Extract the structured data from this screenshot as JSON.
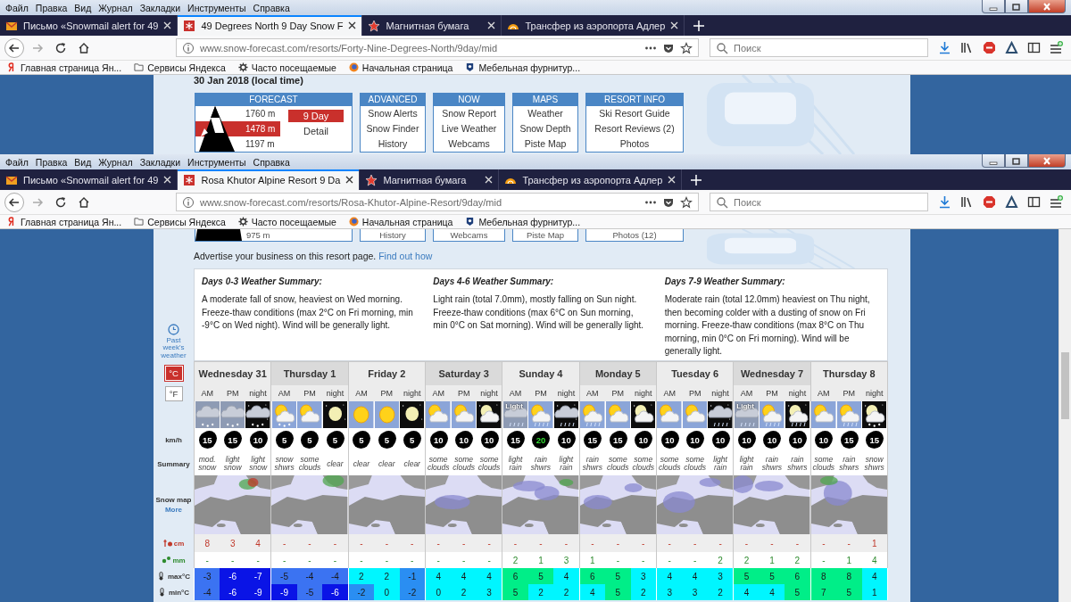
{
  "windows": [
    {
      "menu": [
        "Файл",
        "Правка",
        "Вид",
        "Журнал",
        "Закладки",
        "Инструменты",
        "Справка"
      ],
      "tabs": [
        {
          "title": "Письмо «Snowmail alert for 49",
          "selected": false
        },
        {
          "title": "49 Degrees North 9 Day Snow F",
          "selected": true
        },
        {
          "title": "Магнитная бумага",
          "selected": false
        },
        {
          "title": "Трансфер из аэропорта Адлер",
          "selected": false
        }
      ],
      "address": {
        "url": "www.snow-forecast.com/resorts/Forty-Nine-Degrees-North/9day/mid"
      },
      "search": {
        "placeholder": "Поиск"
      },
      "bookmarks": [
        "Главная страница Ян...",
        "Сервисы Яндекса",
        "Часто посещаемые",
        "Начальная страница",
        "Мебельная фурнитур..."
      ],
      "page": {
        "kind": "resort-menu",
        "date": "30 Jan 2018 (local time)",
        "forecast": {
          "title": "FORECAST",
          "elevations": [
            {
              "label": "1760 m",
              "selected": false
            },
            {
              "label": "1478 m",
              "selected": true
            },
            {
              "label": "1197 m",
              "selected": false
            }
          ],
          "views": [
            {
              "label": "9 Day",
              "selected": true
            },
            {
              "label": "Detail",
              "selected": false
            }
          ]
        },
        "menus": [
          {
            "title": "ADVANCED",
            "items": [
              "Snow Alerts",
              "Snow Finder",
              "History"
            ]
          },
          {
            "title": "NOW",
            "items": [
              "Snow Report",
              "Live Weather",
              "Webcams"
            ]
          },
          {
            "title": "MAPS",
            "items": [
              "Weather",
              "Snow Depth",
              "Piste Map"
            ]
          },
          {
            "title": "RESORT INFO",
            "items": [
              "Ski Resort Guide",
              "Resort Reviews (2)",
              "Photos"
            ]
          }
        ]
      }
    },
    {
      "menu": [
        "Файл",
        "Правка",
        "Вид",
        "Журнал",
        "Закладки",
        "Инструменты",
        "Справка"
      ],
      "tabs": [
        {
          "title": "Письмо «Snowmail alert for 49",
          "selected": false
        },
        {
          "title": "Rosa Khutor Alpine Resort 9 Da",
          "selected": true
        },
        {
          "title": "Магнитная бумага",
          "selected": false
        },
        {
          "title": "Трансфер из аэропорта Адлер",
          "selected": false
        }
      ],
      "address": {
        "url": "www.snow-forecast.com/resorts/Rosa-Khutor-Alpine-Resort/9day/mid"
      },
      "search": {
        "placeholder": "Поиск"
      },
      "bookmarks": [
        "Главная страница Ян...",
        "Сервисы Яндекса",
        "Часто посещаемые",
        "Начальная страница",
        "Мебельная фурнитур..."
      ],
      "page": {
        "kind": "forecast",
        "nav_strip": {
          "elevation": "975 m",
          "items": [
            "History",
            "Webcams",
            "Piste Map",
            "Photos (12)"
          ]
        },
        "advert": {
          "text": "Advertise your business on this resort page.",
          "link": "Find out how"
        },
        "past_weather": "Past week's weather",
        "units": [
          {
            "label": "°C",
            "selected": true
          },
          {
            "label": "°F",
            "selected": false
          }
        ],
        "row_labels": {
          "wind": "km/h",
          "summary": "Summary",
          "snow_map": "Snow map",
          "more": "More",
          "snow": "cm",
          "rain": "mm",
          "max": "max°C",
          "min": "min°C"
        },
        "summaries": [
          {
            "title": "Days 0-3 Weather Summary:",
            "text": "A moderate fall of snow, heaviest on Wed morning. Freeze-thaw conditions (max 2°C on Fri morning, min -9°C on Wed night). Wind will be generally light."
          },
          {
            "title": "Days 4-6 Weather Summary:",
            "text": "Light rain (total 7.0mm), mostly falling on Sun night. Freeze-thaw conditions (max 6°C on Sun morning, min 0°C on Sat morning). Wind will be generally light."
          },
          {
            "title": "Days 7-9 Weather Summary:",
            "text": "Moderate rain (total 12.0mm) heaviest on Thu night, then becoming colder with a dusting of snow on Fri morning. Freeze-thaw conditions (max 8°C on Thu morning, min 0°C on Fri morning). Wind will be generally light."
          }
        ],
        "days": [
          {
            "name": "Wednesday 31",
            "periods": [
              {
                "label": "AM",
                "kind": "cloud-snow",
                "wind": {
                  "speed": "15",
                  "gusty": false
                },
                "summary": "mod. snow",
                "snow": "8",
                "rain": "-",
                "max": {
                  "value": "-3",
                  "color": "#3b73f2"
                },
                "min": {
                  "value": "-4",
                  "color": "#3b73f2"
                }
              },
              {
                "label": "PM",
                "kind": "cloud-snow",
                "wind": {
                  "speed": "15",
                  "gusty": false
                },
                "summary": "light snow",
                "snow": "3",
                "rain": "-",
                "max": {
                  "value": "-6",
                  "color": "#0a14e6"
                },
                "min": {
                  "value": "-6",
                  "color": "#0a14e6"
                }
              },
              {
                "label": "night",
                "kind": "night-cloud-snow",
                "wind": {
                  "speed": "10",
                  "gusty": false
                },
                "summary": "light snow",
                "snow": "4",
                "rain": "-",
                "max": {
                  "value": "-7",
                  "color": "#0a14e6"
                },
                "min": {
                  "value": "-9",
                  "color": "#0a14e6"
                }
              }
            ]
          },
          {
            "name": "Thursday 1",
            "periods": [
              {
                "label": "AM",
                "kind": "sun-cloud-snow",
                "wind": {
                  "speed": "5",
                  "gusty": false
                },
                "summary": "snow shwrs",
                "snow": "-",
                "rain": "-",
                "max": {
                  "value": "-5",
                  "color": "#3b73f2"
                },
                "min": {
                  "value": "-9",
                  "color": "#0a14e6"
                }
              },
              {
                "label": "PM",
                "kind": "sun-cloud",
                "wind": {
                  "speed": "5",
                  "gusty": false
                },
                "summary": "some clouds",
                "snow": "-",
                "rain": "-",
                "max": {
                  "value": "-4",
                  "color": "#3b73f2"
                },
                "min": {
                  "value": "-5",
                  "color": "#3b73f2"
                }
              },
              {
                "label": "night",
                "kind": "moon",
                "wind": {
                  "speed": "5",
                  "gusty": false
                },
                "summary": "clear",
                "snow": "-",
                "rain": "-",
                "max": {
                  "value": "-4",
                  "color": "#3b73f2"
                },
                "min": {
                  "value": "-6",
                  "color": "#0a14e6"
                }
              }
            ]
          },
          {
            "name": "Friday 2",
            "periods": [
              {
                "label": "AM",
                "kind": "sun",
                "wind": {
                  "speed": "5",
                  "gusty": false
                },
                "summary": "clear",
                "snow": "-",
                "rain": "-",
                "max": {
                  "value": "2",
                  "color": "#00f6ff"
                },
                "min": {
                  "value": "-2",
                  "color": "#2a8ef2"
                }
              },
              {
                "label": "PM",
                "kind": "sun",
                "wind": {
                  "speed": "5",
                  "gusty": false
                },
                "summary": "clear",
                "snow": "-",
                "rain": "-",
                "max": {
                  "value": "2",
                  "color": "#00f6ff"
                },
                "min": {
                  "value": "0",
                  "color": "#00f6ff"
                }
              },
              {
                "label": "night",
                "kind": "moon",
                "wind": {
                  "speed": "5",
                  "gusty": false
                },
                "summary": "clear",
                "snow": "-",
                "rain": "-",
                "max": {
                  "value": "-1",
                  "color": "#2a8ef2"
                },
                "min": {
                  "value": "-2",
                  "color": "#2a8ef2"
                }
              }
            ]
          },
          {
            "name": "Saturday 3",
            "periods": [
              {
                "label": "AM",
                "kind": "sun-cloud",
                "wind": {
                  "speed": "10",
                  "gusty": false
                },
                "summary": "some clouds",
                "snow": "-",
                "rain": "-",
                "max": {
                  "value": "4",
                  "color": "#00f6ff"
                },
                "min": {
                  "value": "0",
                  "color": "#00f6ff"
                }
              },
              {
                "label": "PM",
                "kind": "sun-cloud",
                "wind": {
                  "speed": "10",
                  "gusty": false
                },
                "summary": "some clouds",
                "snow": "-",
                "rain": "-",
                "max": {
                  "value": "4",
                  "color": "#00f6ff"
                },
                "min": {
                  "value": "2",
                  "color": "#00f6ff"
                }
              },
              {
                "label": "night",
                "kind": "moon-cloud",
                "wind": {
                  "speed": "10",
                  "gusty": false
                },
                "summary": "some clouds",
                "snow": "-",
                "rain": "-",
                "max": {
                  "value": "4",
                  "color": "#00f6ff"
                },
                "min": {
                  "value": "3",
                  "color": "#00f6ff"
                }
              }
            ]
          },
          {
            "name": "Sunday 4",
            "periods": [
              {
                "label": "AM",
                "kind": "cloud-rain",
                "caption": "Light",
                "wind": {
                  "speed": "15",
                  "gusty": false
                },
                "summary": "light rain",
                "snow": "-",
                "rain": "2",
                "max": {
                  "value": "6",
                  "color": "#00ee88"
                },
                "min": {
                  "value": "5",
                  "color": "#00ee88"
                }
              },
              {
                "label": "PM",
                "kind": "sun-cloud-rain",
                "wind": {
                  "speed": "20",
                  "gusty": true
                },
                "summary": "rain shwrs",
                "snow": "-",
                "rain": "1",
                "max": {
                  "value": "5",
                  "color": "#00ee88"
                },
                "min": {
                  "value": "2",
                  "color": "#00f6ff"
                }
              },
              {
                "label": "night",
                "kind": "night-cloud-rain",
                "wind": {
                  "speed": "10",
                  "gusty": false
                },
                "summary": "light rain",
                "snow": "-",
                "rain": "3",
                "max": {
                  "value": "4",
                  "color": "#00f6ff"
                },
                "min": {
                  "value": "2",
                  "color": "#00f6ff"
                }
              }
            ]
          },
          {
            "name": "Monday 5",
            "periods": [
              {
                "label": "AM",
                "kind": "sun-cloud-rain",
                "wind": {
                  "speed": "15",
                  "gusty": false
                },
                "summary": "rain shwrs",
                "snow": "-",
                "rain": "1",
                "max": {
                  "value": "6",
                  "color": "#00ee88"
                },
                "min": {
                  "value": "4",
                  "color": "#00f6ff"
                }
              },
              {
                "label": "PM",
                "kind": "sun-cloud",
                "wind": {
                  "speed": "15",
                  "gusty": false
                },
                "summary": "some clouds",
                "snow": "-",
                "rain": "-",
                "max": {
                  "value": "5",
                  "color": "#00ee88"
                },
                "min": {
                  "value": "5",
                  "color": "#00ee88"
                }
              },
              {
                "label": "night",
                "kind": "moon-cloud",
                "wind": {
                  "speed": "10",
                  "gusty": false
                },
                "summary": "some clouds",
                "snow": "-",
                "rain": "-",
                "max": {
                  "value": "3",
                  "color": "#00f6ff"
                },
                "min": {
                  "value": "2",
                  "color": "#00f6ff"
                }
              }
            ]
          },
          {
            "name": "Tuesday 6",
            "periods": [
              {
                "label": "AM",
                "kind": "sun-cloud",
                "wind": {
                  "speed": "10",
                  "gusty": false
                },
                "summary": "some clouds",
                "snow": "-",
                "rain": "-",
                "max": {
                  "value": "4",
                  "color": "#00f6ff"
                },
                "min": {
                  "value": "3",
                  "color": "#00f6ff"
                }
              },
              {
                "label": "PM",
                "kind": "sun-cloud",
                "wind": {
                  "speed": "10",
                  "gusty": false
                },
                "summary": "some clouds",
                "snow": "-",
                "rain": "-",
                "max": {
                  "value": "4",
                  "color": "#00f6ff"
                },
                "min": {
                  "value": "3",
                  "color": "#00f6ff"
                }
              },
              {
                "label": "night",
                "kind": "night-cloud-rain",
                "wind": {
                  "speed": "10",
                  "gusty": false
                },
                "summary": "light rain",
                "snow": "-",
                "rain": "2",
                "max": {
                  "value": "3",
                  "color": "#00f6ff"
                },
                "min": {
                  "value": "2",
                  "color": "#00f6ff"
                }
              }
            ]
          },
          {
            "name": "Wednesday 7",
            "periods": [
              {
                "label": "AM",
                "kind": "cloud-rain",
                "caption": "Light",
                "wind": {
                  "speed": "10",
                  "gusty": false
                },
                "summary": "light rain",
                "snow": "-",
                "rain": "2",
                "max": {
                  "value": "5",
                  "color": "#00ee88"
                },
                "min": {
                  "value": "4",
                  "color": "#00f6ff"
                }
              },
              {
                "label": "PM",
                "kind": "sun-cloud-rain",
                "wind": {
                  "speed": "10",
                  "gusty": false
                },
                "summary": "rain shwrs",
                "snow": "-",
                "rain": "1",
                "max": {
                  "value": "5",
                  "color": "#00ee88"
                },
                "min": {
                  "value": "4",
                  "color": "#00f6ff"
                }
              },
              {
                "label": "night",
                "kind": "moon-rain",
                "wind": {
                  "speed": "10",
                  "gusty": false
                },
                "summary": "rain shwrs",
                "snow": "-",
                "rain": "2",
                "max": {
                  "value": "6",
                  "color": "#00ee88"
                },
                "min": {
                  "value": "5",
                  "color": "#00ee88"
                }
              }
            ]
          },
          {
            "name": "Thursday 8",
            "periods": [
              {
                "label": "AM",
                "kind": "sun-cloud",
                "wind": {
                  "speed": "10",
                  "gusty": false
                },
                "summary": "some clouds",
                "snow": "-",
                "rain": "-",
                "max": {
                  "value": "8",
                  "color": "#00ee88"
                },
                "min": {
                  "value": "7",
                  "color": "#00ee88"
                }
              },
              {
                "label": "PM",
                "kind": "sun-cloud-rain",
                "wind": {
                  "speed": "15",
                  "gusty": false
                },
                "summary": "rain shwrs",
                "snow": "-",
                "rain": "1",
                "max": {
                  "value": "8",
                  "color": "#00ee88"
                },
                "min": {
                  "value": "5",
                  "color": "#00ee88"
                }
              },
              {
                "label": "night",
                "kind": "moon-snow",
                "wind": {
                  "speed": "15",
                  "gusty": false
                },
                "summary": "snow shwrs",
                "snow": "1",
                "rain": "4",
                "max": {
                  "value": "4",
                  "color": "#00f6ff"
                },
                "min": {
                  "value": "1",
                  "color": "#00f6ff"
                }
              }
            ]
          }
        ]
      }
    }
  ]
}
